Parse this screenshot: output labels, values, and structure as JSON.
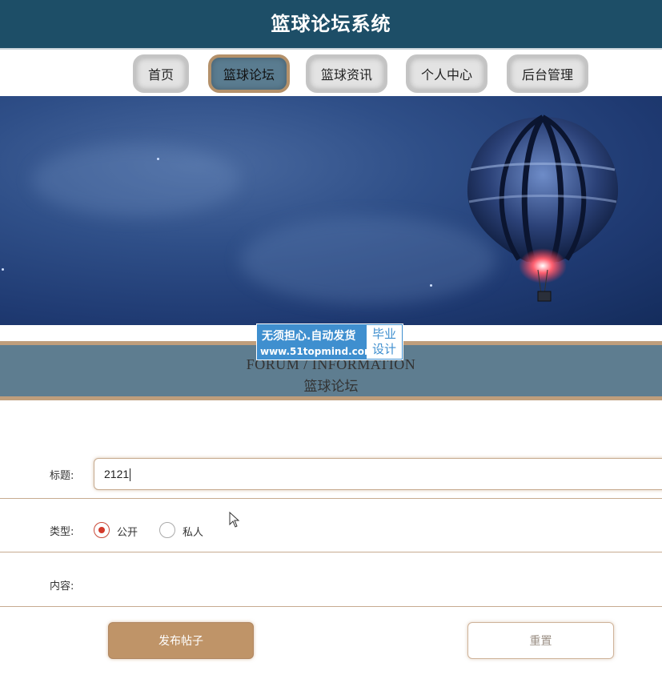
{
  "header": {
    "title": "篮球论坛系统"
  },
  "nav": {
    "items": [
      {
        "label": "首页"
      },
      {
        "label": "篮球论坛",
        "active": true
      },
      {
        "label": "篮球资讯"
      },
      {
        "label": "个人中心"
      },
      {
        "label": "后台管理"
      }
    ]
  },
  "section": {
    "title_en": "FORUM / INFORMATION",
    "title_zh": "篮球论坛"
  },
  "watermark": {
    "main": "无须担心.自动发货",
    "url": "www.51topmind.com",
    "box_line1": "毕业",
    "box_line2": "设计"
  },
  "form": {
    "title_label": "标题:",
    "title_value": "2121",
    "type_label": "类型:",
    "type_options": [
      {
        "label": "公开",
        "selected": true
      },
      {
        "label": "私人",
        "selected": false
      }
    ],
    "content_label": "内容:",
    "submit_label": "发布帖子",
    "reset_label": "重置"
  },
  "colors": {
    "header_bg": "#1d4e67",
    "accent": "#bf9468",
    "band": "#5e7d90"
  }
}
